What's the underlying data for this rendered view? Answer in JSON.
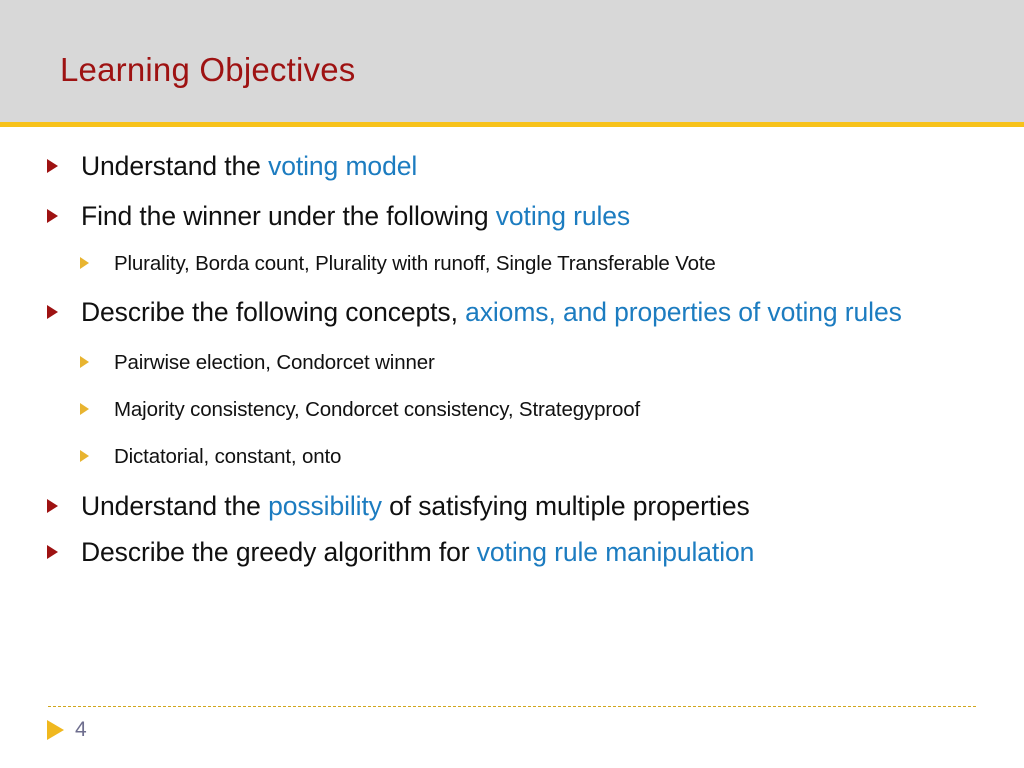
{
  "slide": {
    "title": "Learning Objectives",
    "number": "4",
    "colors": {
      "title_band": "#d8d8d8",
      "title_text": "#9e1212",
      "accent_bar": "#f7c21a",
      "highlight_text": "#1c7cc0",
      "body_text": "#101010",
      "level1_bullet": "#9e1212",
      "level2_bullet": "#e8b430",
      "footer_rule": "#d1a61c",
      "slide_number": "#6e6e8e",
      "background": "#ffffff"
    }
  },
  "content": {
    "items": [
      {
        "level": 1,
        "segments": [
          {
            "text": "Understand the ",
            "highlight": false
          },
          {
            "text": "voting model",
            "highlight": true
          }
        ]
      },
      {
        "level": 1,
        "segments": [
          {
            "text": "Find the winner under the following ",
            "highlight": false
          },
          {
            "text": "voting rules",
            "highlight": true
          }
        ]
      },
      {
        "level": 2,
        "segments": [
          {
            "text": "Plurality, Borda count, Plurality with runoff, Single Transferable Vote",
            "highlight": false
          }
        ]
      },
      {
        "level": 1,
        "segments": [
          {
            "text": "Describe the following concepts, ",
            "highlight": false
          },
          {
            "text": "axioms, and properties of voting rules",
            "highlight": true
          }
        ]
      },
      {
        "level": 2,
        "segments": [
          {
            "text": "Pairwise election, Condorcet winner",
            "highlight": false
          }
        ]
      },
      {
        "level": 2,
        "segments": [
          {
            "text": "Majority consistency, Condorcet consistency, Strategyproof",
            "highlight": false
          }
        ]
      },
      {
        "level": 2,
        "segments": [
          {
            "text": "Dictatorial, constant, onto",
            "highlight": false
          }
        ]
      },
      {
        "level": 1,
        "segments": [
          {
            "text": "Understand the ",
            "highlight": false
          },
          {
            "text": "possibility",
            "highlight": true
          },
          {
            "text": " of satisfying multiple properties",
            "highlight": false
          }
        ]
      },
      {
        "level": 1,
        "segments": [
          {
            "text": "Describe the greedy algorithm for ",
            "highlight": false
          },
          {
            "text": "voting rule manipulation",
            "highlight": true
          }
        ]
      }
    ]
  }
}
